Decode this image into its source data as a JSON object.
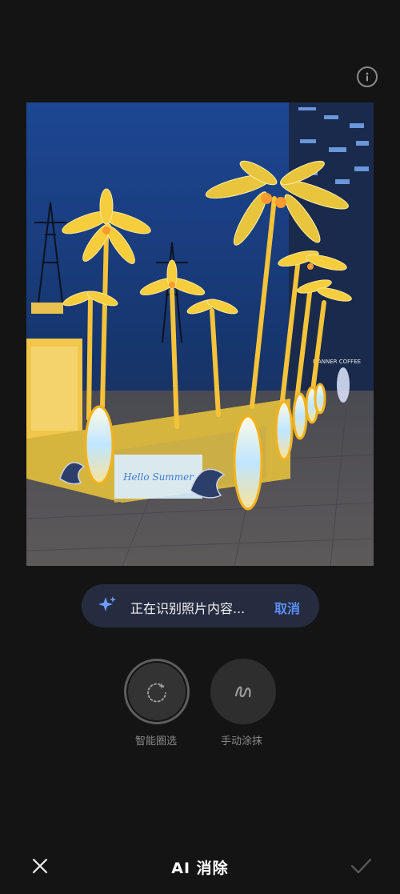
{
  "header": {
    "info_icon": "info-icon"
  },
  "photo": {
    "sign_text": "Hello Summer",
    "storefront_text": "MANNER COFFEE"
  },
  "recognition": {
    "icon": "sparkle-icon",
    "status_text": "正在识别照片内容...",
    "cancel_label": "取消"
  },
  "tools": [
    {
      "icon": "smart-select-icon",
      "label": "智能圈选",
      "selected": true
    },
    {
      "icon": "brush-icon",
      "label": "手动涂抹",
      "selected": false
    }
  ],
  "bottom_bar": {
    "close_icon": "close-icon",
    "title": "AI 消除",
    "confirm_icon": "check-icon"
  },
  "colors": {
    "background": "#141414",
    "pill": "#252c40",
    "accent": "#5b8ef5",
    "label_gray": "#8a8a8a"
  }
}
